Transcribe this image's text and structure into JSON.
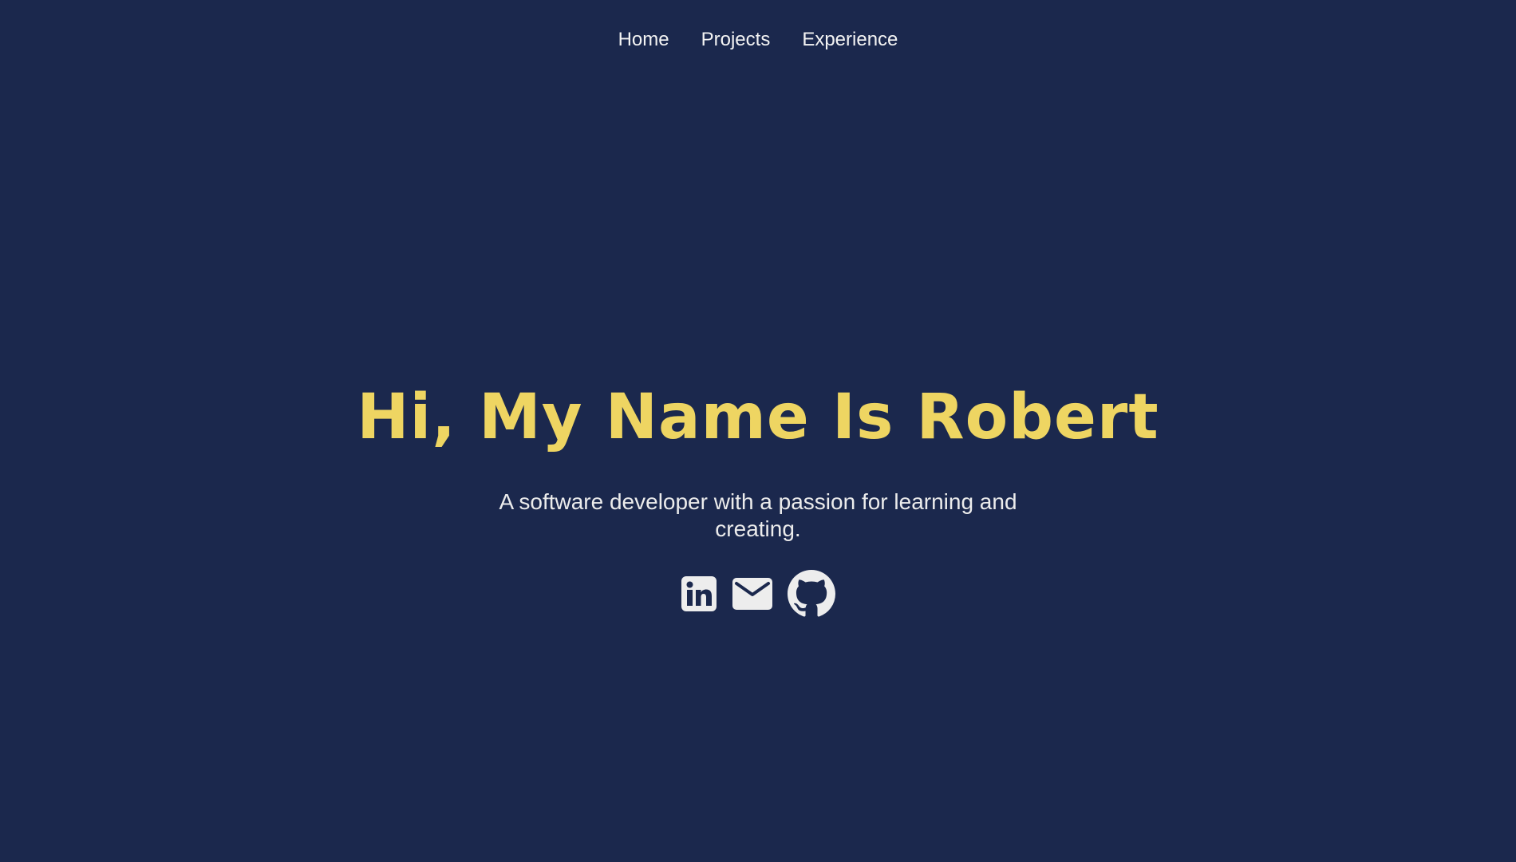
{
  "nav": {
    "items": [
      {
        "label": "Home"
      },
      {
        "label": "Projects"
      },
      {
        "label": "Experience"
      }
    ]
  },
  "hero": {
    "title": "Hi, My Name Is Robert",
    "tagline": "A software developer with a passion for learning and creating."
  },
  "socials": [
    {
      "icon": "linkedin-icon"
    },
    {
      "icon": "mail-icon"
    },
    {
      "icon": "github-icon"
    }
  ],
  "colors": {
    "background": "#1b284d",
    "accent": "#eed562",
    "text": "#f3f3f3",
    "icon": "#ededed"
  }
}
